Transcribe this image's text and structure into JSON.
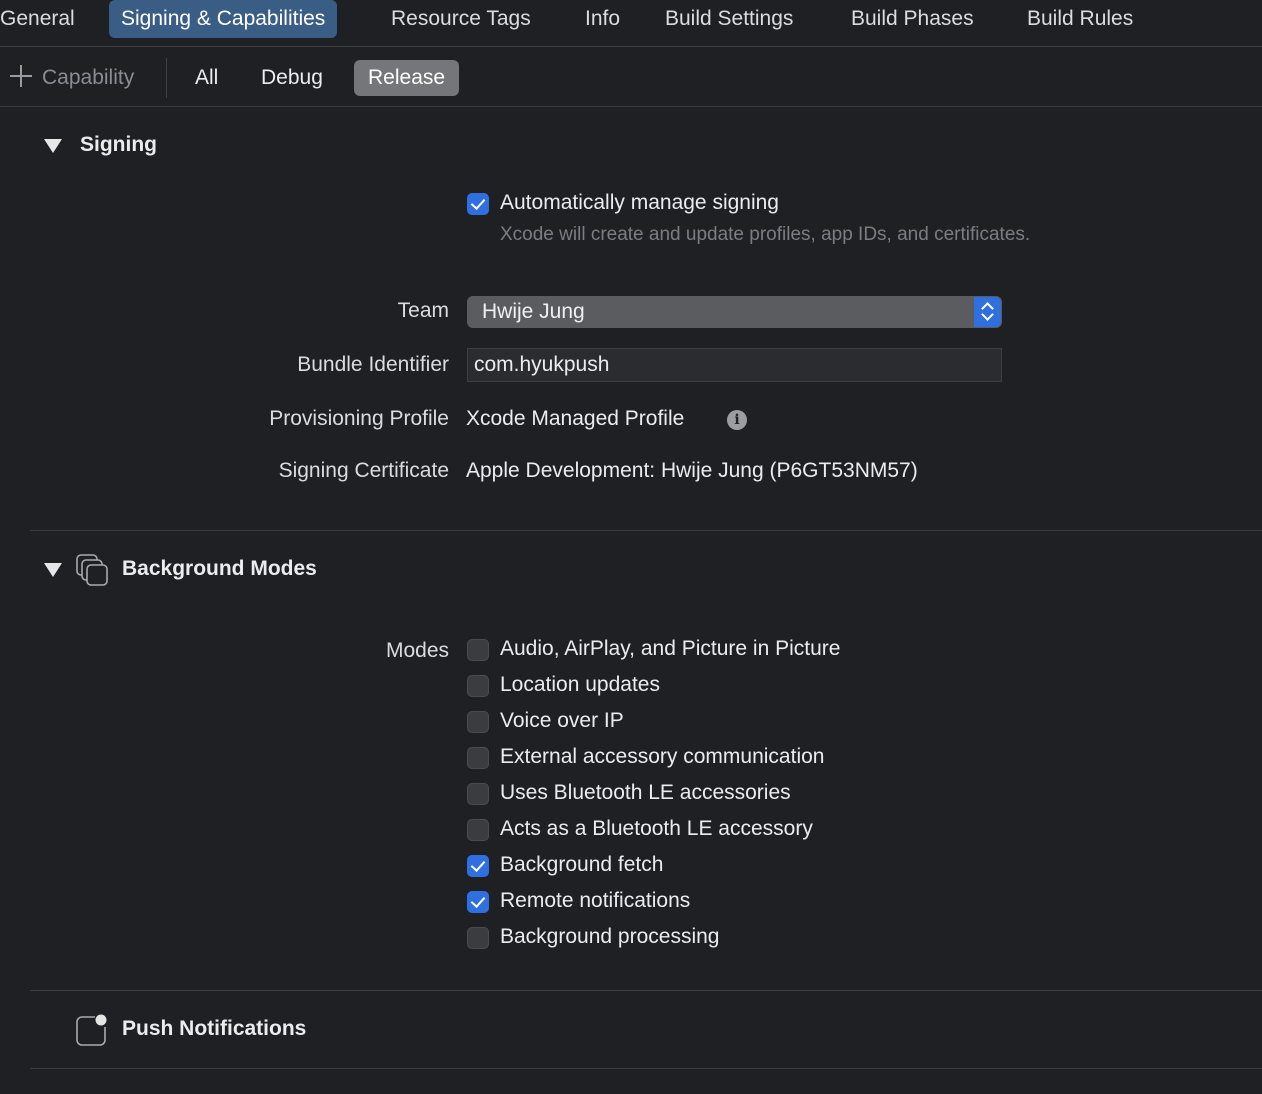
{
  "tabs": [
    {
      "label": "General",
      "active": false
    },
    {
      "label": "Signing & Capabilities",
      "active": true
    },
    {
      "label": "Resource Tags",
      "active": false
    },
    {
      "label": "Info",
      "active": false
    },
    {
      "label": "Build Settings",
      "active": false
    },
    {
      "label": "Build Phases",
      "active": false
    },
    {
      "label": "Build Rules",
      "active": false
    }
  ],
  "toolbar": {
    "capability_label": "Capability",
    "configurations": [
      {
        "label": "All",
        "active": false
      },
      {
        "label": "Debug",
        "active": false
      },
      {
        "label": "Release",
        "active": true
      }
    ]
  },
  "signing": {
    "title": "Signing",
    "auto_manage": {
      "label": "Automatically manage signing",
      "checked": true
    },
    "auto_manage_hint": "Xcode will create and update profiles, app IDs, and certificates.",
    "team_label": "Team",
    "team_value": "Hwije Jung",
    "bundle_label": "Bundle Identifier",
    "bundle_value": "com.hyukpush",
    "profile_label": "Provisioning Profile",
    "profile_value": "Xcode Managed Profile",
    "certificate_label": "Signing Certificate",
    "certificate_value": "Apple Development: Hwije Jung (P6GT53NM57)"
  },
  "background_modes": {
    "title": "Background Modes",
    "modes_label": "Modes",
    "modes": [
      {
        "label": "Audio, AirPlay, and Picture in Picture",
        "checked": false
      },
      {
        "label": "Location updates",
        "checked": false
      },
      {
        "label": "Voice over IP",
        "checked": false
      },
      {
        "label": "External accessory communication",
        "checked": false
      },
      {
        "label": "Uses Bluetooth LE accessories",
        "checked": false
      },
      {
        "label": "Acts as a Bluetooth LE accessory",
        "checked": false
      },
      {
        "label": "Background fetch",
        "checked": true
      },
      {
        "label": "Remote notifications",
        "checked": true
      },
      {
        "label": "Background processing",
        "checked": false
      }
    ]
  },
  "push_notifications": {
    "title": "Push Notifications"
  },
  "colors": {
    "background": "#1f2024",
    "accent": "#2f6fe0",
    "tab_active": "#3a5d85",
    "segment_active": "#75767a"
  }
}
